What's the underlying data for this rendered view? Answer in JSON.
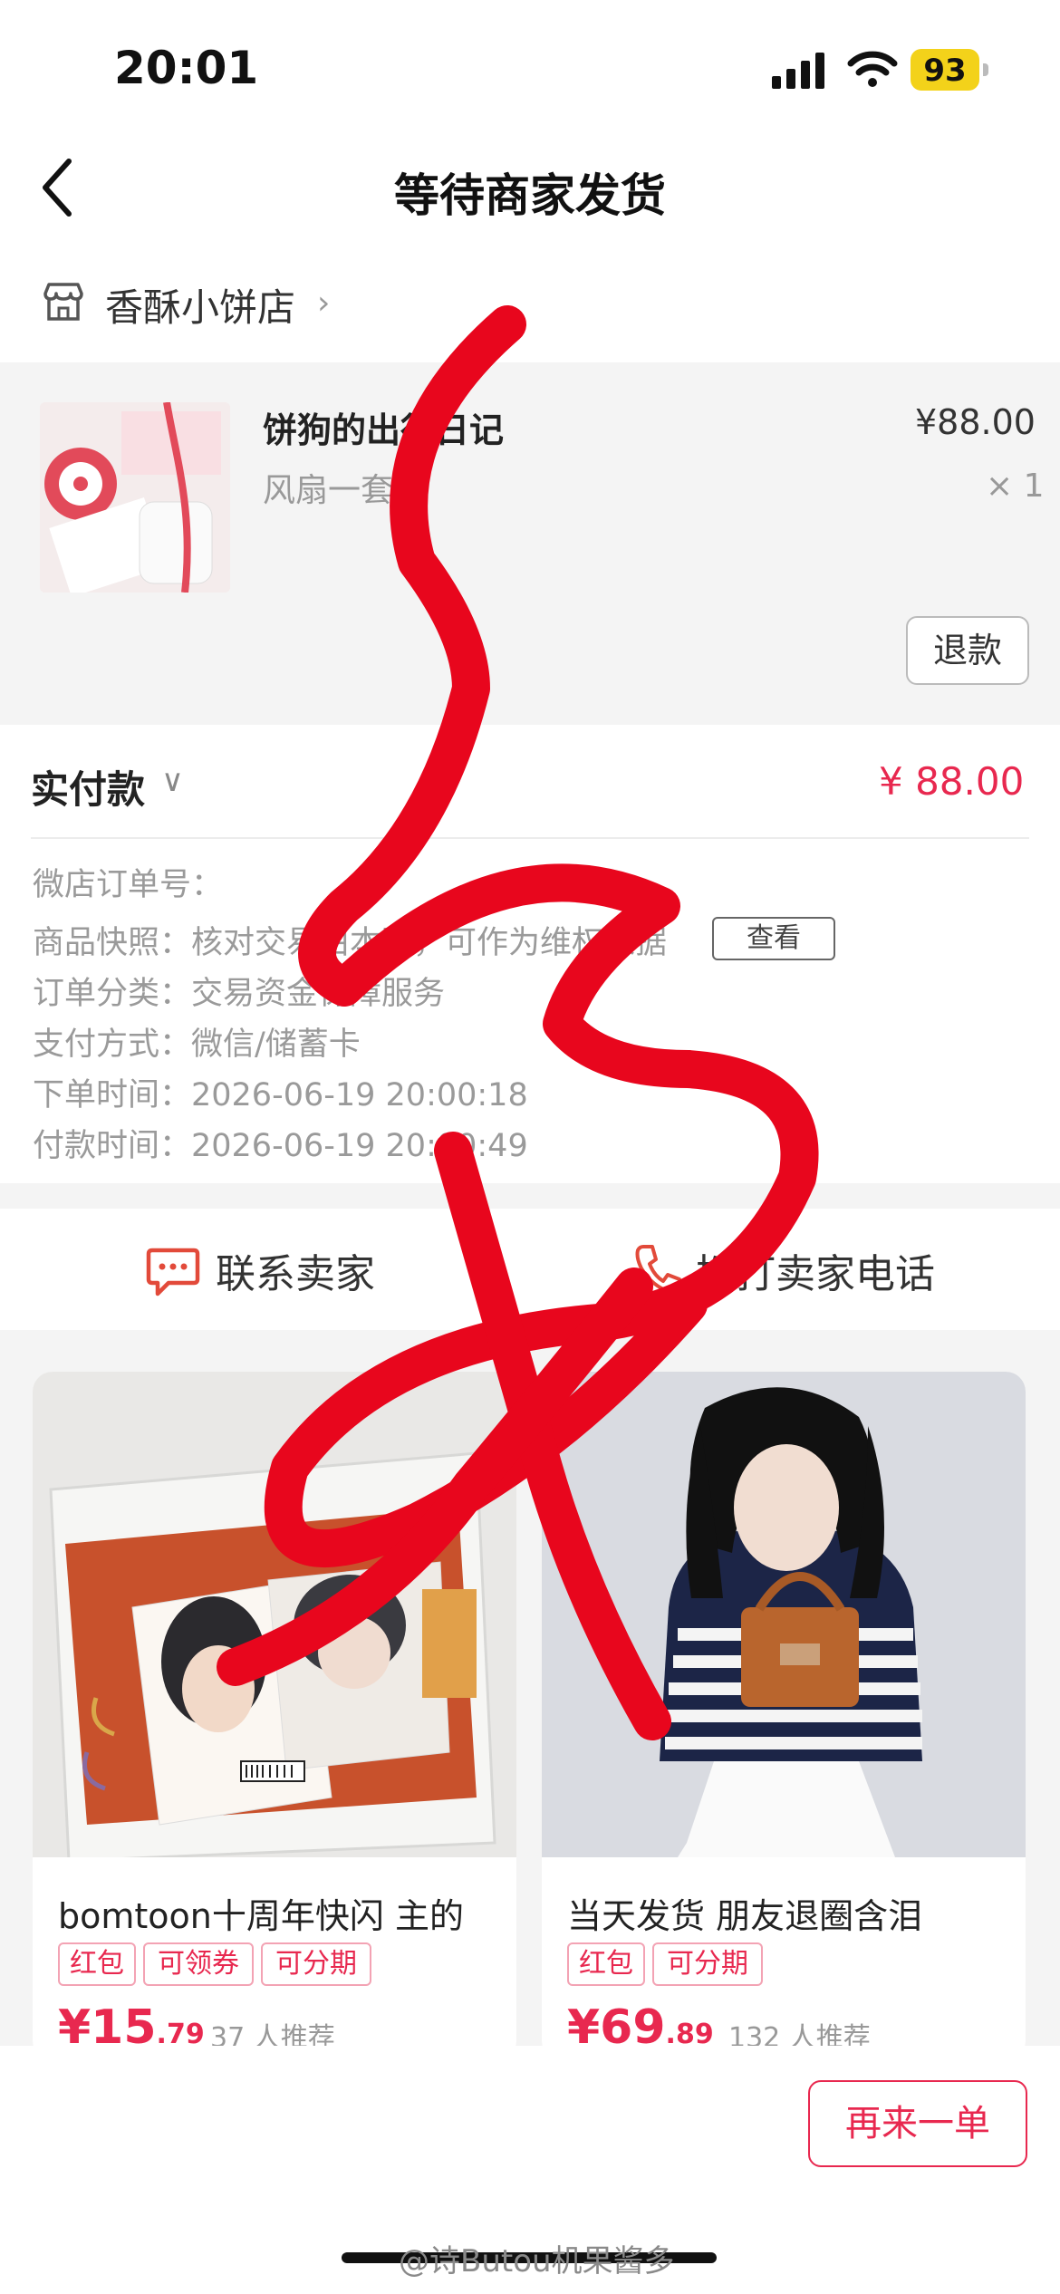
{
  "status_bar": {
    "time": "20:01",
    "battery": "93"
  },
  "nav": {
    "title": "等待商家发货"
  },
  "store": {
    "name": "香酥小饼店"
  },
  "product": {
    "name": "饼狗的出行日记",
    "spec": "风扇一套",
    "price": "¥88.00",
    "quantity": "× 1",
    "refund_label": "退款"
  },
  "payment": {
    "label": "实付款",
    "amount": "¥ 88.00"
  },
  "order_info": {
    "order_no": "微店订单号：",
    "snapshot": "商品快照：核对交易由本页，可作为维权依据",
    "snapshot_button": "查看",
    "category": "订单分类：交易资金保障服务",
    "pay_method": "支付方式：微信/储蓄卡",
    "order_time": "下单时间：2026-06-19 20:00:18",
    "pay_time": "付款时间：2026-06-19 20:00:49"
  },
  "contact": {
    "chat_label": "联系卖家",
    "phone_label": "拨打卖家电话"
  },
  "recommendations": [
    {
      "title": "bomtoon十周年快闪 主的",
      "tags": [
        "红包",
        "可领券",
        "可分期"
      ],
      "price_int": "¥15",
      "price_dec": ".79",
      "recommend": "37 人推荐"
    },
    {
      "title": "当天发货 朋友退圈含泪",
      "tags": [
        "红包",
        "可分期"
      ],
      "price_int": "¥69",
      "price_dec": ".89",
      "recommend": "132 人推荐"
    }
  ],
  "bottom": {
    "reorder_label": "再来一单"
  },
  "watermark": "@诗Butou机果酱多",
  "colors": {
    "accent": "#e8284f",
    "scribble": "#e8061d",
    "battery": "#f3d21a"
  }
}
